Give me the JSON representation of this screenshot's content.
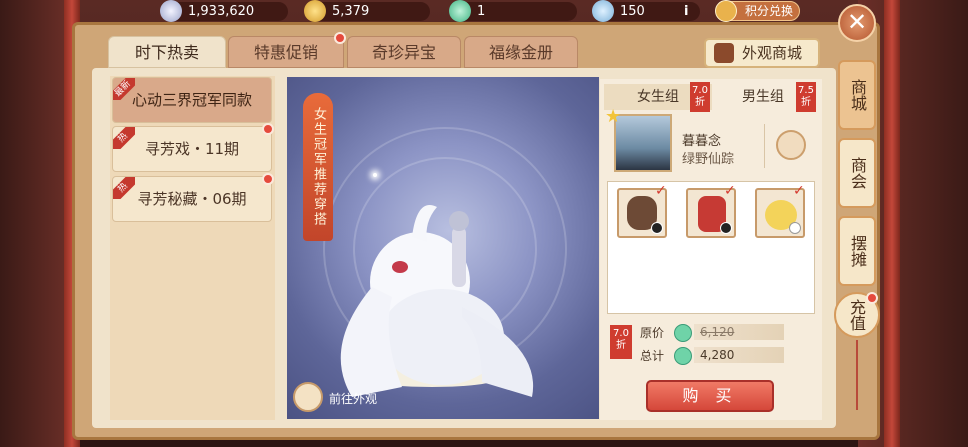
{
  "resources": [
    {
      "icon": "silver-coin-icon",
      "value": "1,933,620"
    },
    {
      "icon": "gold-ingot-icon",
      "value": "5,379"
    },
    {
      "icon": "jade-coin-icon",
      "value": "1"
    },
    {
      "icon": "treasure-icon",
      "value": "150"
    }
  ],
  "top_actions": {
    "info": "i",
    "points_exchange": "积分兑换"
  },
  "tabs": [
    {
      "label": "时下热卖",
      "active": true,
      "dot": false
    },
    {
      "label": "特惠促销",
      "active": false,
      "dot": true
    },
    {
      "label": "奇珍异宝",
      "active": false,
      "dot": false
    },
    {
      "label": "福缘金册",
      "active": false,
      "dot": false
    }
  ],
  "appearance_mall": "外观商城",
  "list_items": [
    {
      "label": "心动三界冠军同款",
      "badge": "最新",
      "active": true,
      "dot": false
    },
    {
      "label": "寻芳戏・11期",
      "badge": "热",
      "active": false,
      "dot": true
    },
    {
      "label": "寻芳秘藏・06期",
      "badge": "热",
      "active": false,
      "dot": true
    }
  ],
  "showcase": {
    "banner": "女生冠军推荐穿搭",
    "goto_label": "前往外观"
  },
  "groups": [
    {
      "label": "女生组",
      "discount": "7.0",
      "unit": "折",
      "active": true
    },
    {
      "label": "男生组",
      "discount": "7.5",
      "unit": "折",
      "active": false
    }
  ],
  "profile": {
    "name": "暮暮念",
    "subtitle": "绿野仙踪"
  },
  "items": [
    {
      "icon": "hair-accessory-icon",
      "marker": "yin-yang"
    },
    {
      "icon": "red-outfit-icon",
      "marker": "yin-yang"
    },
    {
      "icon": "yellow-pet-icon",
      "marker": "white"
    }
  ],
  "pricing": {
    "discount": "7.0",
    "unit": "折",
    "original_label": "原价",
    "original_value": "6,120",
    "total_label": "总计",
    "total_value": "4,280"
  },
  "buy_label": "购 买",
  "side_tabs": [
    {
      "label": "商城",
      "active": true
    },
    {
      "label": "商会",
      "active": false
    },
    {
      "label": "摆摊",
      "active": false
    },
    {
      "label": "充值",
      "active": false
    }
  ],
  "colors": {
    "accent_red": "#d5473a",
    "frame": "#cfa677",
    "panel": "#f0e3cb"
  }
}
